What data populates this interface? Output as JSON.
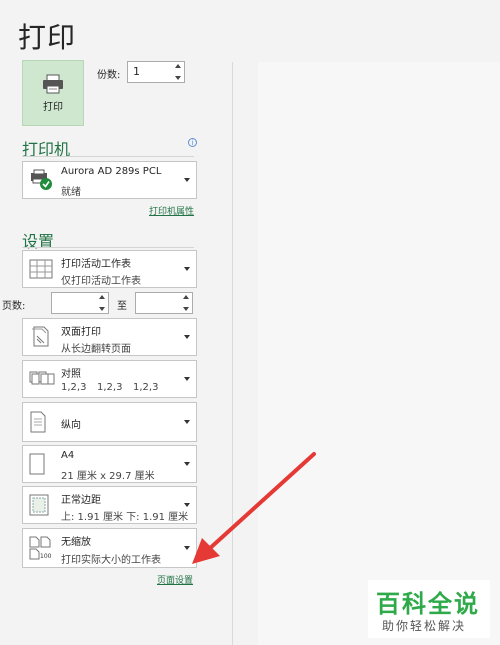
{
  "title": "打印",
  "print_button": {
    "label": "打印"
  },
  "copies": {
    "label": "份数:",
    "value": "1"
  },
  "printer_section": {
    "title": "打印机",
    "name": "Aurora AD 289s PCL",
    "status": "就绪",
    "properties_link": "打印机属性"
  },
  "settings_section": {
    "title": "设置",
    "scope": {
      "line1": "打印活动工作表",
      "line2": "仅打印活动工作表"
    },
    "pages": {
      "label": "页数:",
      "to": "至"
    },
    "duplex": {
      "line1": "双面打印",
      "line2": "从长边翻转页面"
    },
    "collate": {
      "line1": "对照",
      "line2_a": "1,2,3",
      "line2_b": "1,2,3",
      "line2_c": "1,2,3"
    },
    "orientation": {
      "line1": "纵向"
    },
    "paper": {
      "line1": "A4",
      "line2": "21 厘米 x 29.7 厘米"
    },
    "margins": {
      "line1": "正常边距",
      "line2": "上: 1.91 厘米 下: 1.91 厘米"
    },
    "scaling": {
      "line1": "无缩放",
      "line2": "打印实际大小的工作表",
      "icon_text": "100"
    },
    "page_setup_link": "页面设置"
  },
  "watermark": {
    "big": "百科全说",
    "small": "助你轻松解决"
  },
  "colors": {
    "accent": "#217346",
    "print_button_bg": "#cfe7cf",
    "arrow": "#e53935",
    "watermark": "#2eaa4a"
  }
}
